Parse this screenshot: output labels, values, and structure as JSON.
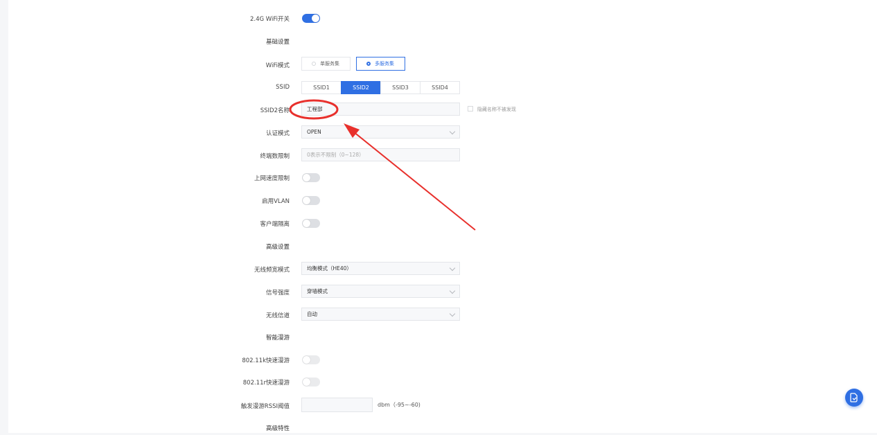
{
  "wifi_24g": {
    "label": "2.4G WiFi开关",
    "enabled": true
  },
  "basic": {
    "section_title": "基础设置",
    "wifi_mode": {
      "label": "WiFi模式",
      "options": [
        "单服务集",
        "多服务集"
      ],
      "selected": "多服务集"
    },
    "ssid": {
      "label": "SSID",
      "tabs": [
        "SSID1",
        "SSID2",
        "SSID3",
        "SSID4"
      ],
      "active": "SSID2"
    },
    "ssid_name": {
      "label": "SSID2名称",
      "value": "工程部",
      "hide_label": "隐藏名称不被发现"
    },
    "auth_mode": {
      "label": "认证模式",
      "value": "OPEN"
    },
    "client_limit": {
      "label": "终端数限制",
      "placeholder": "0表示不限制（0~128）"
    },
    "speed_limit": {
      "label": "上网速度限制"
    },
    "vlan": {
      "label": "启用VLAN"
    },
    "client_isolation": {
      "label": "客户端隔离"
    }
  },
  "advanced": {
    "section_title": "高级设置",
    "bandwidth": {
      "label": "无线频宽模式",
      "value": "均衡模式（HE40）"
    },
    "signal": {
      "label": "信号强度",
      "value": "穿墙模式"
    },
    "channel": {
      "label": "无线信道",
      "value": "自动"
    }
  },
  "roaming": {
    "section_title": "智能漫游",
    "k": {
      "label": "802.11k快速漫游"
    },
    "r": {
      "label": "802.11r快速漫游"
    },
    "rssi": {
      "label": "触发漫游RSSI阈值",
      "unit": "dbm（-95~-60)"
    }
  },
  "advanced_features": {
    "section_title": "高级特性"
  },
  "colors": {
    "accent": "#2f6fe3",
    "annotation": "#e8302c"
  },
  "icons": {
    "fab": "export-icon"
  }
}
